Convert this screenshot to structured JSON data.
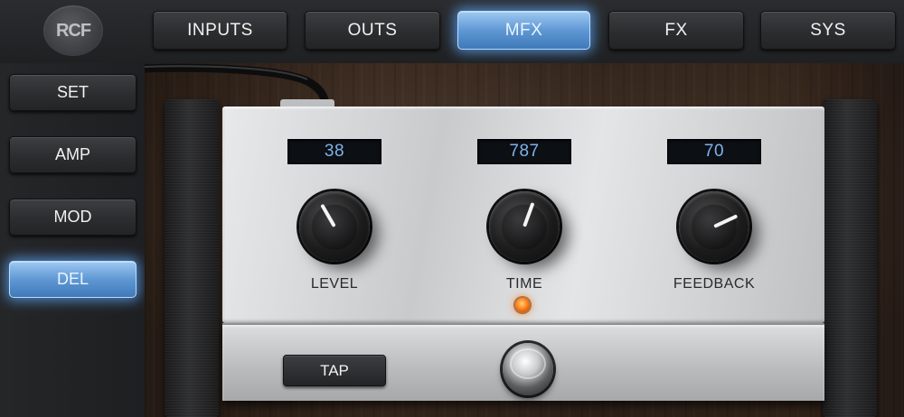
{
  "brand": {
    "logo_text": "RCF"
  },
  "top_tabs": [
    {
      "label": "INPUTS",
      "active": false
    },
    {
      "label": "OUTS",
      "active": false
    },
    {
      "label": "MFX",
      "active": true
    },
    {
      "label": "FX",
      "active": false
    },
    {
      "label": "SYS",
      "active": false
    }
  ],
  "side_menu": [
    {
      "label": "SET",
      "active": false
    },
    {
      "label": "AMP",
      "active": false
    },
    {
      "label": "MOD",
      "active": false
    },
    {
      "label": "DEL",
      "active": true
    }
  ],
  "pedal": {
    "knobs": [
      {
        "label": "LEVEL",
        "value": "38"
      },
      {
        "label": "TIME",
        "value": "787"
      },
      {
        "label": "FEEDBACK",
        "value": "70"
      }
    ],
    "tap_button_label": "TAP",
    "tap_led_state": "on"
  },
  "colors": {
    "accent_active": "#5f98d4",
    "display_text": "#7fb2ea",
    "led": "#ff7a14"
  }
}
